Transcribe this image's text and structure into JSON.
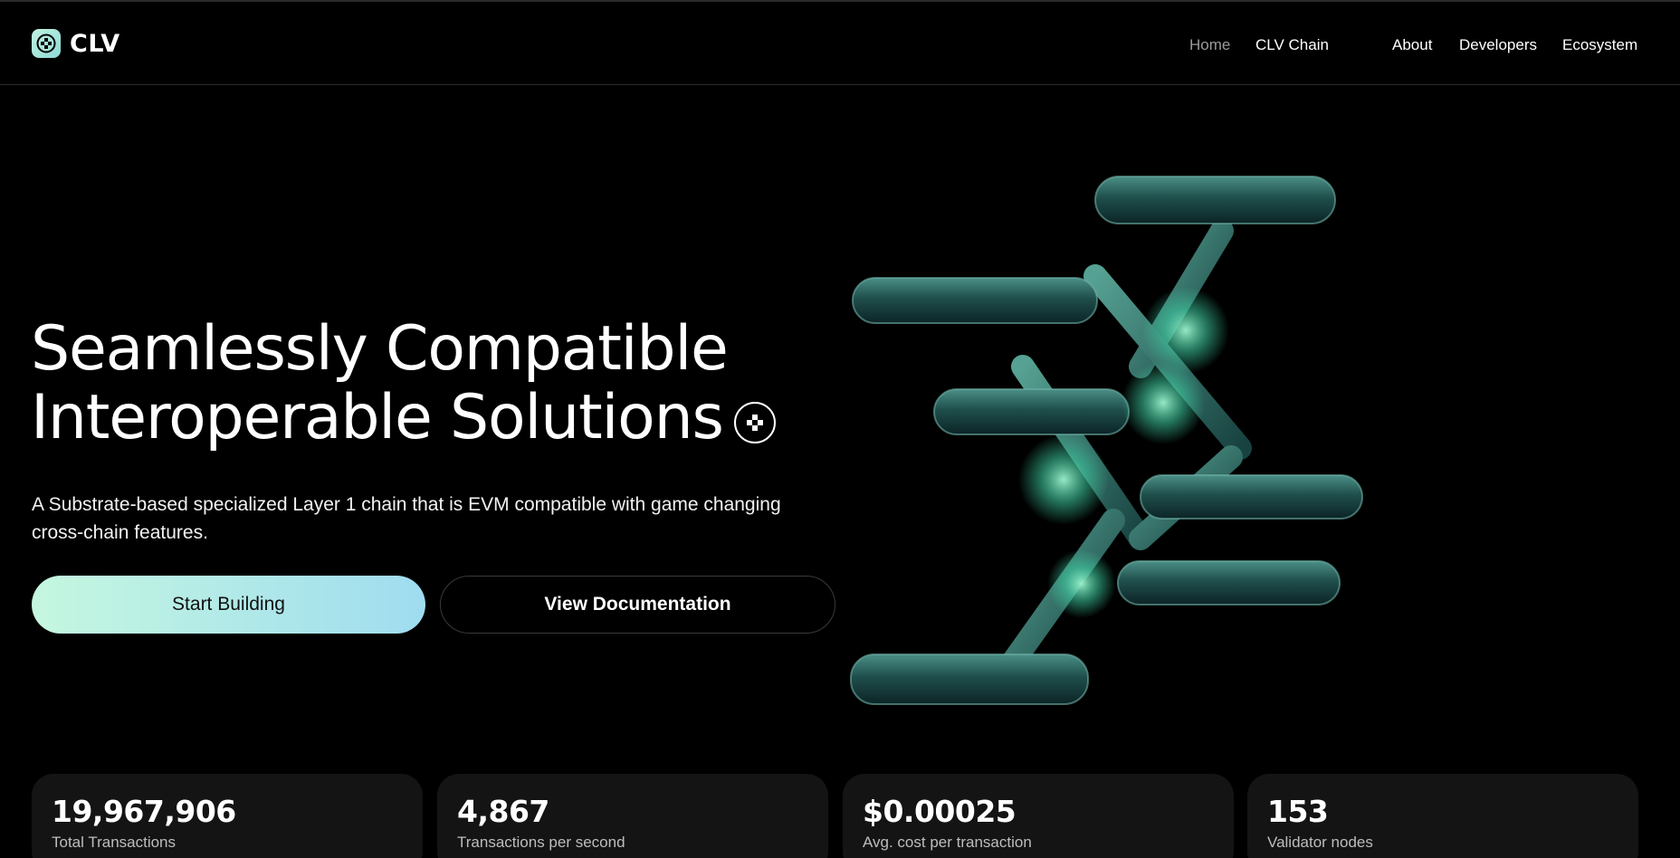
{
  "brand": {
    "name": "CLV",
    "logo_icon": "clv-logo-icon"
  },
  "nav": {
    "items": [
      {
        "label": "Home",
        "active": true
      },
      {
        "label": "CLV Chain"
      },
      {
        "label": "About"
      },
      {
        "label": "Developers"
      },
      {
        "label": "Ecosystem"
      }
    ]
  },
  "hero": {
    "headline_line1": "Seamlessly Compatible",
    "headline_line2": "Interoperable Solutions",
    "subtitle": "A Substrate-based specialized Layer 1 chain that is EVM compatible with game changing cross-chain features.",
    "primary_cta": "Start Building",
    "secondary_cta": "View Documentation",
    "accent_colors": [
      "#c5f7df",
      "#9fdcf0",
      "#3fd1a4"
    ]
  },
  "stats": [
    {
      "value": "19,967,906",
      "label": "Total Transactions"
    },
    {
      "value": "4,867",
      "label": "Transactions per second"
    },
    {
      "value": "$0.00025",
      "label": "Avg. cost per transaction"
    },
    {
      "value": "153",
      "label": "Validator nodes"
    }
  ]
}
